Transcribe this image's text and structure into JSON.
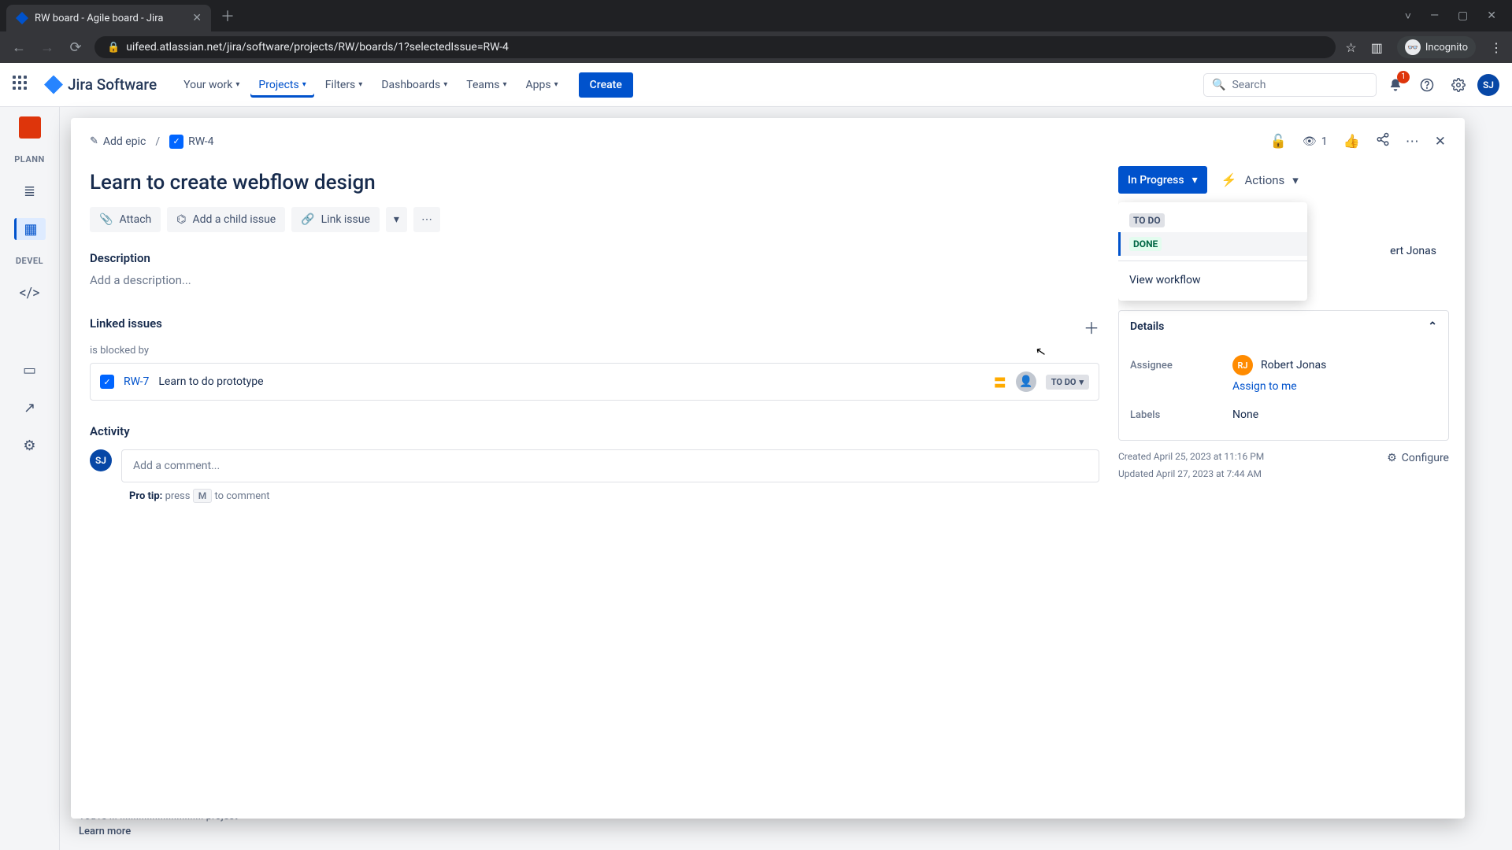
{
  "browser": {
    "tab_title": "RW board - Agile board - Jira",
    "url": "uifeed.atlassian.net/jira/software/projects/RW/boards/1?selectedIssue=RW-4",
    "incognito": "Incognito"
  },
  "header": {
    "product": "Jira Software",
    "nav": {
      "your_work": "Your work",
      "projects": "Projects",
      "filters": "Filters",
      "dashboards": "Dashboards",
      "teams": "Teams",
      "apps": "Apps"
    },
    "create": "Create",
    "search_placeholder": "Search",
    "notif_count": "1",
    "avatar_initials": "SJ"
  },
  "sidebar": {
    "planning": "PLANN",
    "development": "DEVEL"
  },
  "issue": {
    "breadcrumb": {
      "add_epic": "Add epic",
      "key": "RW-4"
    },
    "watch_count": "1",
    "title": "Learn to create webflow design",
    "actions": {
      "attach": "Attach",
      "child": "Add a child issue",
      "link": "Link issue"
    },
    "description_label": "Description",
    "description_placeholder": "Add a description...",
    "linked_label": "Linked issues",
    "linked_relation": "is blocked by",
    "linked_items": [
      {
        "key": "RW-7",
        "summary": "Learn to do prototype",
        "status": "TO DO"
      }
    ],
    "activity_label": "Activity",
    "comment_placeholder": "Add a comment...",
    "protip_prefix": "Pro tip:",
    "protip_press": "press",
    "protip_key": "M",
    "protip_suffix": "to comment"
  },
  "right": {
    "status": "In Progress",
    "actions_label": "Actions",
    "dropdown": {
      "todo": "TO DO",
      "done": "DONE",
      "view_workflow": "View workflow"
    },
    "partial_reporter": "ert Jonas",
    "details_label": "Details",
    "assignee_label": "Assignee",
    "assignee_name": "Robert Jonas",
    "assignee_initials": "RJ",
    "assign_to_me": "Assign to me",
    "labels_label": "Labels",
    "labels_value": "None",
    "created": "Created April 25, 2023 at 11:16 PM",
    "updated": "Updated April 27, 2023 at 7:44 AM",
    "configure": "Configure"
  },
  "footer": {
    "line1": "You're ... ............................... project",
    "learn_more": "Learn more"
  }
}
